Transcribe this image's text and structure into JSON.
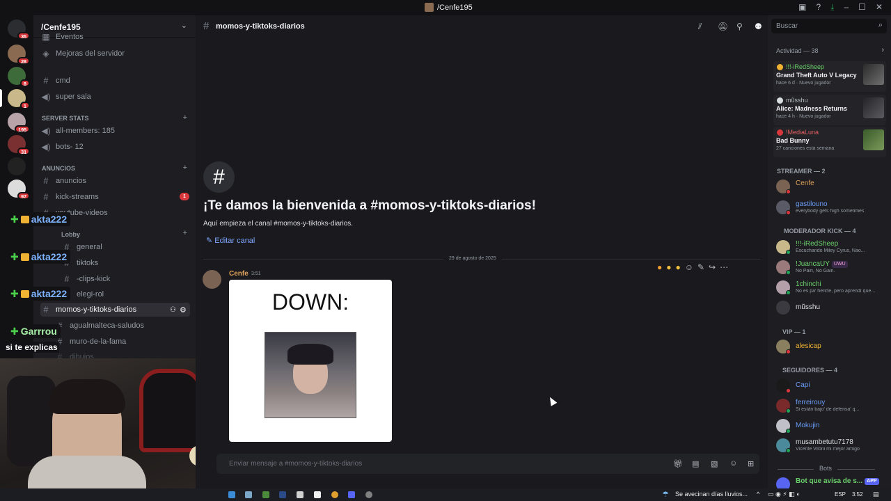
{
  "window": {
    "title": "/Cenfe195"
  },
  "server": {
    "name": "/Cenfe195"
  },
  "guild_badges": [
    "35",
    "28",
    "8",
    "1",
    "195",
    "31",
    "97"
  ],
  "channels": {
    "items": [
      {
        "label": "Eventos"
      },
      {
        "label": "Mejoras del servidor"
      },
      {
        "label": "cmd"
      },
      {
        "label": "super sala"
      },
      {
        "label": "all-members: 185"
      },
      {
        "label": "bots- 12"
      },
      {
        "label": "anuncios"
      },
      {
        "label": "kick-streams"
      },
      {
        "label": "youtube-videos"
      },
      {
        "label": "general"
      },
      {
        "label": "tiktoks"
      },
      {
        "label": "-clips-kick"
      },
      {
        "label": "elegi-rol"
      },
      {
        "label": "momos-y-tiktoks-diarios"
      },
      {
        "label": "agualmalteca-saludos"
      },
      {
        "label": "muro-de-la-fama"
      },
      {
        "label": "dibujos"
      }
    ],
    "categories": {
      "server_stats": "SERVER STATS",
      "anuncios": "ANUNCIOS",
      "lobby": "Lobby"
    },
    "kick_streams_badge": "1"
  },
  "overlay": {
    "chat_tags": [
      "akta222",
      "akta222",
      "akta222",
      "Garrrou"
    ],
    "caption": "si te explicas"
  },
  "chat": {
    "channel_name": "momos-y-tiktoks-diarios",
    "welcome_title": "¡Te damos la bienvenida a #momos-y-tiktoks-diarios!",
    "welcome_sub": "Aquí empieza el canal #momos-y-tiktoks-diarios.",
    "edit_channel": "Editar canal",
    "date_divider": "29 de agosto de 2025",
    "message": {
      "author": "Cenfe",
      "time": "3:51",
      "image_text": "DOWN:"
    },
    "composer_placeholder": "Enviar mensaje a #momos-y-tiktoks-diarios"
  },
  "members": {
    "search_placeholder": "Buscar",
    "activity_title": "Actividad — 38",
    "activities": [
      {
        "user": "!!!-iRedSheep",
        "game": "Grand Theft Auto V Legacy",
        "meta": "hace 6 d · Nuevo jugador"
      },
      {
        "user": "mũsshu",
        "game": "Alice: Madness Returns",
        "meta": "hace 4 h · Nuevo jugador"
      },
      {
        "user": "!MediaLuna",
        "game": "Bad Bunny",
        "meta": "27 canciones esta semana"
      }
    ],
    "sections": [
      {
        "title": "STREAMER — 2",
        "members": [
          {
            "name": "Cenfe",
            "sub": "",
            "color": "#e0a25a"
          },
          {
            "name": "gastilouno",
            "sub": "everybody gets high sometimes",
            "color": "#6a9cf5"
          }
        ]
      },
      {
        "title": "MODERADOR KICK — 4",
        "members": [
          {
            "name": "!!!-iRedSheep",
            "sub": "Escuchando Miley Cyrus, Nao...",
            "color": "#6bd16b"
          },
          {
            "name": "!JuancaUY",
            "sub": "No Pain, No Gain.",
            "color": "#f2f3f5",
            "pill": "UWU"
          },
          {
            "name": "1chinchi",
            "sub": "No es pa' herirte, pero aprendí que...",
            "color": "#f2f3f5"
          },
          {
            "name": "mũsshu",
            "sub": "",
            "color": "#f2f3f5"
          }
        ]
      },
      {
        "title": "VIP — 1",
        "members": [
          {
            "name": "alesicap",
            "sub": "",
            "color": "#f0b232"
          }
        ]
      },
      {
        "title": "SEGUIDORES — 4",
        "members": [
          {
            "name": "Capi",
            "sub": "",
            "color": "#6a9cf5"
          },
          {
            "name": "ferreirouy",
            "sub": "Si están bajo' de defensa' q...",
            "color": "#6a9cf5"
          },
          {
            "name": "Mokujin",
            "sub": "",
            "color": "#6a9cf5"
          },
          {
            "name": "musambetutu7178",
            "sub": "Vicente Viloni mi mejor amigo",
            "color": "#dbdee1"
          }
        ]
      }
    ],
    "bots_title": "Bots",
    "bot": {
      "name": "Bot que avisa de s...",
      "pill": "APP"
    }
  },
  "taskbar": {
    "weather": "Se avecinan días lluvios...",
    "lang": "ESP",
    "time": "3:52"
  },
  "colors": {
    "accent": "#5865f2",
    "link": "#7ea6ff",
    "danger": "#da373c",
    "online": "#23a55a",
    "dnd": "#da373c"
  }
}
